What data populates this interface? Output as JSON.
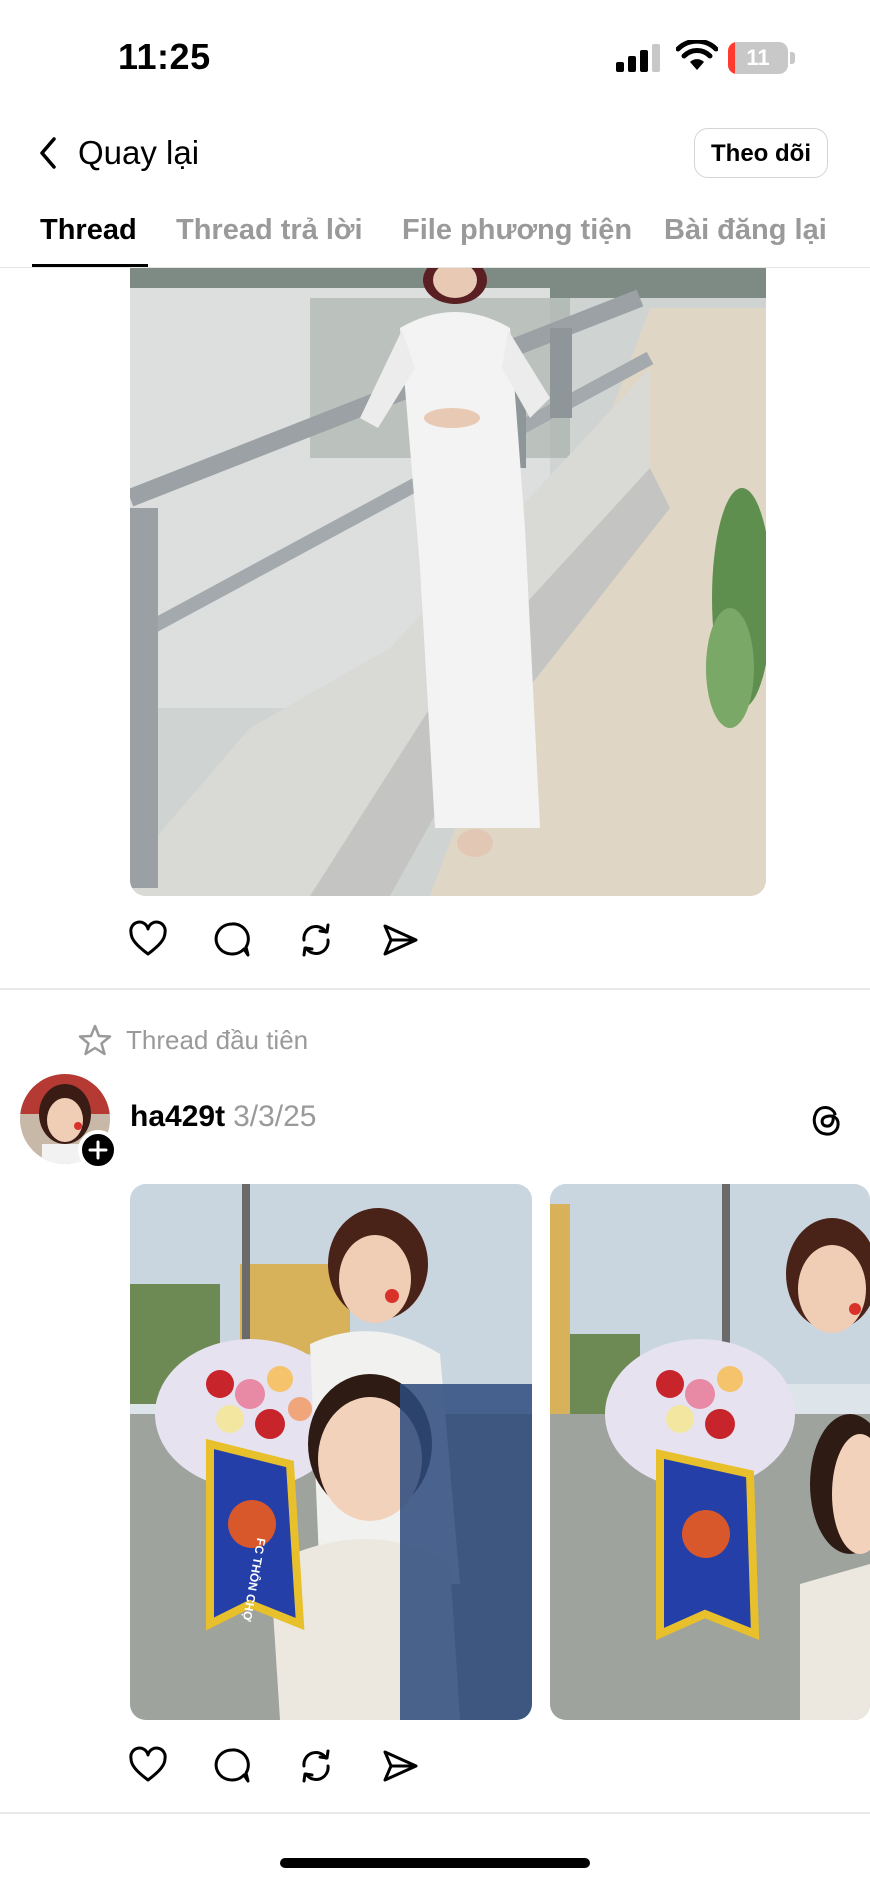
{
  "status_bar": {
    "time": "11:25",
    "battery_level": "11",
    "battery_fraction": 0.11,
    "icons": [
      "cellular-signal-icon",
      "wifi-icon",
      "battery-icon"
    ]
  },
  "header": {
    "back_label": "Quay lại",
    "follow_label": "Theo dõi",
    "back_icon": "chevron-left-icon"
  },
  "tabs": [
    {
      "label": "Thread",
      "active": true
    },
    {
      "label": "Thread trả lời",
      "active": false
    },
    {
      "label": "File phương tiện",
      "active": false
    },
    {
      "label": "Bài đăng lại",
      "active": false
    }
  ],
  "posts": [
    {
      "image": "woman-in-white-ao-dai-by-waterfront-railing",
      "actions": [
        "heart-icon",
        "comment-icon",
        "repost-icon",
        "share-icon"
      ]
    },
    {
      "pinned_label": "Thread đầu tiên",
      "username": "ha429t",
      "date": "3/3/25",
      "images": [
        "two-women-selfie-with-flower-bouquet-and-pennant",
        "two-women-selfie-with-flower-bouquet-and-pennant-2"
      ],
      "pennant_text": "FC THÔN CHỢ",
      "actions": [
        "heart-icon",
        "comment-icon",
        "repost-icon",
        "share-icon"
      ]
    }
  ],
  "colors": {
    "text_primary": "#000000",
    "text_secondary": "#9a9a9a",
    "divider": "#e8e8e8",
    "battery_low": "#ff3b30"
  }
}
